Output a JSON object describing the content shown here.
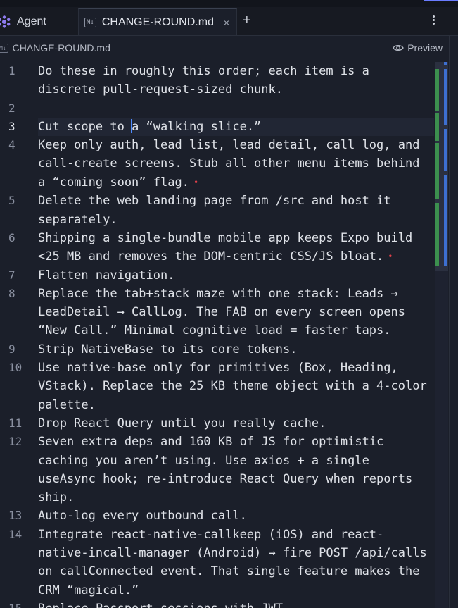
{
  "tabs": {
    "agent_label": "Agent",
    "file_label": "CHANGE-ROUND.md",
    "md_badge": "M↓",
    "close": "×",
    "add": "+"
  },
  "breadcrumb": {
    "md_badge": "M↓",
    "file": "CHANGE-ROUND.md",
    "preview_label": "Preview"
  },
  "editor": {
    "current_line": 3,
    "lines": [
      {
        "n": "1",
        "text": "Do these in roughly this order; each item is a discrete pull-request-sized chunk."
      },
      {
        "n": "2",
        "text": ""
      },
      {
        "n": "3",
        "text": "Cut scope to a “walking slice.”"
      },
      {
        "n": "4",
        "text": "Keep only auth, lead list, lead detail, call log, and call-create screens. Stub all other menu items behind a “coming soon” flag."
      },
      {
        "n": "5",
        "text": "Delete the web landing page from /src and host it separately."
      },
      {
        "n": "6",
        "text": "Shipping a single-bundle mobile app keeps Expo build <25 MB and removes the DOM-centric CSS/JS bloat."
      },
      {
        "n": "7",
        "text": "Flatten navigation."
      },
      {
        "n": "8",
        "text": "Replace the tab+stack maze with one stack: Leads → LeadDetail → CallLog. The FAB on every screen opens “New Call.” Minimal cognitive load = faster taps."
      },
      {
        "n": "9",
        "text": "Strip NativeBase to its core tokens."
      },
      {
        "n": "10",
        "text": "Use native-base only for primitives (Box, Heading, VStack). Replace the 25 KB theme object with a 4-color palette."
      },
      {
        "n": "11",
        "text": "Drop React Query until you really cache."
      },
      {
        "n": "12",
        "text": "Seven extra deps and 160 KB of JS for optimistic caching you aren’t using. Use axios + a single useAsync hook; re-introduce React Query when reports ship."
      },
      {
        "n": "13",
        "text": "Auto-log every outbound call."
      },
      {
        "n": "14",
        "text": "Integrate react-native-callkeep (iOS) and react-native-incall-manager (Android) → fire POST /api/calls on callConnected event. That single feature makes the CRM “magical.”"
      },
      {
        "n": "15",
        "text": "Replace Passport sessions with JWT."
      }
    ],
    "dots": {
      "4": "•",
      "6": "•"
    }
  },
  "colors": {
    "background": "#1b1f2a",
    "caret": "#4f8cff",
    "dot": "#e0404a",
    "scroll_green": "#3c8f4e",
    "scroll_blue": "#3d6fd0"
  }
}
